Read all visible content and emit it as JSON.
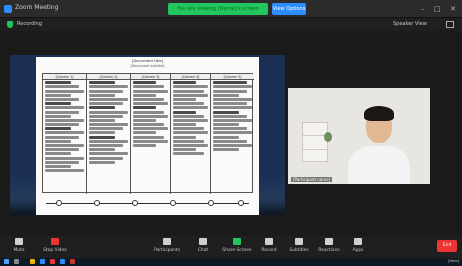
{
  "app": {
    "title": "Zoom Meeting"
  },
  "banner": {
    "sharing_text": "You are viewing [Name]'s screen"
  },
  "view_options": {
    "label": "View Options"
  },
  "window": {
    "min": "–",
    "max": "□",
    "close": "✕"
  },
  "info": {
    "recording": "Recording",
    "view": "Speaker View"
  },
  "document": {
    "title": "[Document title]",
    "subtitle": "[Document subtitle]",
    "headers": [
      "[Column 1]",
      "[Column 2]",
      "[Column 3]",
      "[Column 4]",
      "[Column 5]"
    ]
  },
  "video": {
    "name": "[Participant name]"
  },
  "toolbar": {
    "items": [
      {
        "label": "Mute",
        "icon": "microphone-icon"
      },
      {
        "label": "Stop Video",
        "icon": "video-camera-icon"
      },
      {
        "label": "Participants",
        "icon": "participants-icon"
      },
      {
        "label": "Chat",
        "icon": "chat-icon"
      },
      {
        "label": "Share Screen",
        "icon": "share-screen-icon"
      },
      {
        "label": "Record",
        "icon": "record-icon"
      },
      {
        "label": "Subtitles",
        "icon": "subtitles-icon"
      },
      {
        "label": "Reactions",
        "icon": "reactions-icon"
      },
      {
        "label": "Apps",
        "icon": "apps-icon"
      }
    ],
    "end": "End"
  },
  "taskbar": {
    "clock": "[time]"
  },
  "colors": {
    "share_green": "#22c55e",
    "zoom_blue": "#2d8cff",
    "end_red": "#e33"
  }
}
